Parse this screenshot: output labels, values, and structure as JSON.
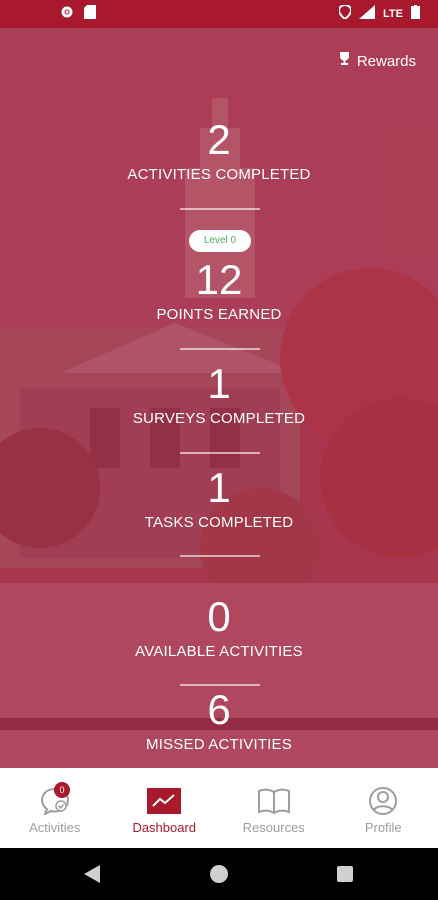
{
  "header": {
    "rewards_label": "Rewards"
  },
  "status_bar": {
    "network": "LTE"
  },
  "stats": [
    {
      "value": "2",
      "label": "ACTIVITIES COMPLETED"
    },
    {
      "value": "12",
      "label": "POINTS EARNED",
      "badge": "Level 0"
    },
    {
      "value": "1",
      "label": "SURVEYS COMPLETED"
    },
    {
      "value": "1",
      "label": "TASKS COMPLETED"
    },
    {
      "value": "0",
      "label": "AVAILABLE ACTIVITIES"
    },
    {
      "value": "6",
      "label": "MISSED ACTIVITIES"
    }
  ],
  "nav": {
    "items": [
      {
        "label": "Activities",
        "icon": "chat-icon",
        "badge": "0"
      },
      {
        "label": "Dashboard",
        "icon": "chart-icon",
        "active": true
      },
      {
        "label": "Resources",
        "icon": "book-icon"
      },
      {
        "label": "Profile",
        "icon": "person-icon"
      }
    ]
  },
  "colors": {
    "brand": "#a8192e",
    "level_badge_text": "#4caf50"
  }
}
